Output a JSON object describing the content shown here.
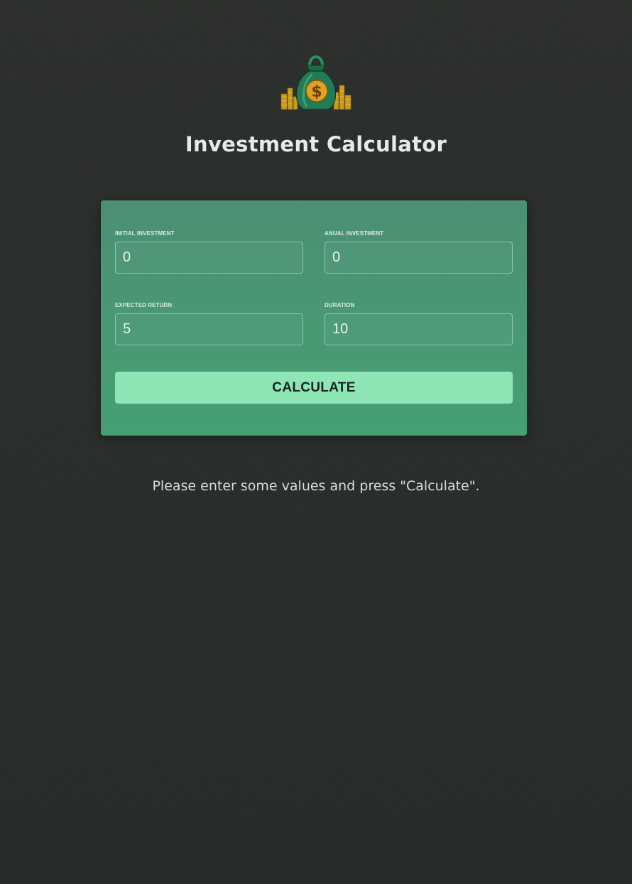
{
  "header": {
    "title": "Investment Calculator",
    "logo_icon": "money-bag-icon"
  },
  "form": {
    "initial_investment": {
      "label": "Initial Investment",
      "value": "0"
    },
    "annual_investment": {
      "label": "Anual Investment",
      "value": "0"
    },
    "expected_return": {
      "label": "Expected Return",
      "value": "5"
    },
    "duration": {
      "label": "Duration",
      "value": "10"
    },
    "calculate_label": "CALCULATE"
  },
  "message": "Please enter some values and press \"Calculate\".",
  "colors": {
    "background": "#2b2e2c",
    "card": "#48977a",
    "button": "#8ee6b7",
    "button_text": "#16241d"
  }
}
